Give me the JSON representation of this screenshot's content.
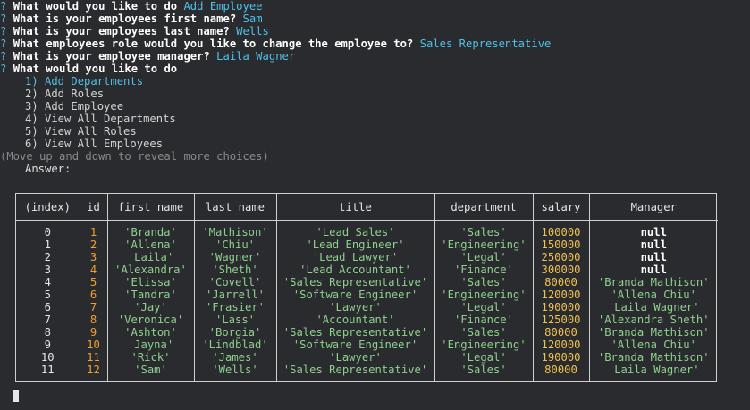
{
  "prompt": {
    "marker": "?",
    "lines": [
      {
        "question": "What would you like to do",
        "answer": "Add Employee"
      },
      {
        "question": "What is your employees first name?",
        "answer": "Sam"
      },
      {
        "question": "What is your employees last name?",
        "answer": "Wells"
      },
      {
        "question": "What employees role would you like to change the employee to?",
        "answer": "Sales Representative"
      },
      {
        "question": "What is your employee manager?",
        "answer": "Laila Wagner"
      },
      {
        "question": "What would you like to do",
        "answer": ""
      }
    ],
    "choices": [
      "1) Add Departments",
      "2) Add Roles",
      "3) Add Employee",
      "4) View All Departments",
      "5) View All Roles",
      "6) View All Employees"
    ],
    "active_choice": 0,
    "hint": "(Move up and down to reveal more choices)",
    "answer_label": "Answer:"
  },
  "table": {
    "columns": [
      "(index)",
      "id",
      "first_name",
      "last_name",
      "title",
      "department",
      "salary",
      "Manager"
    ],
    "index": [
      "0",
      "1",
      "2",
      "3",
      "4",
      "5",
      "6",
      "7",
      "8",
      "9",
      "10",
      "11"
    ],
    "id": [
      "1",
      "2",
      "3",
      "4",
      "5",
      "6",
      "7",
      "8",
      "9",
      "10",
      "11",
      "12"
    ],
    "first_name": [
      "'Branda'",
      "'Allena'",
      "'Laila'",
      "'Alexandra'",
      "'Elissa'",
      "'Tandra'",
      "'Jay'",
      "'Veronica'",
      "'Ashton'",
      "'Jayna'",
      "'Rick'",
      "'Sam'"
    ],
    "last_name": [
      "'Mathison'",
      "'Chiu'",
      "'Wagner'",
      "'Sheth'",
      "'Covell'",
      "'Jarrell'",
      "'Frasier'",
      "'Lass'",
      "'Borgia'",
      "'Lindblad'",
      "'James'",
      "'Wells'"
    ],
    "title": [
      "'Lead Sales'",
      "'Lead Engineer'",
      "'Lead Lawyer'",
      "'Lead Accountant'",
      "'Sales Representative'",
      "'Software Engineer'",
      "'Lawyer'",
      "'Accountant'",
      "'Sales Representative'",
      "'Software Engineer'",
      "'Lawyer'",
      "'Sales Representative'"
    ],
    "department": [
      "'Sales'",
      "'Engineering'",
      "'Legal'",
      "'Finance'",
      "'Sales'",
      "'Engineering'",
      "'Legal'",
      "'Finance'",
      "'Sales'",
      "'Engineering'",
      "'Legal'",
      "'Sales'"
    ],
    "salary": [
      "100000",
      "150000",
      "250000",
      "300000",
      "80000",
      "120000",
      "190000",
      "125000",
      "80000",
      "120000",
      "190000",
      "80000"
    ],
    "manager": [
      "null",
      "null",
      "null",
      "null",
      "'Branda Mathison'",
      "'Allena Chiu'",
      "'Laila Wagner'",
      "'Alexandra Sheth'",
      "'Branda Mathison'",
      "'Allena Chiu'",
      "'Branda Mathison'",
      "'Laila Wagner'"
    ]
  },
  "colors": {
    "background": "#2a2b2e",
    "answer": "#4fc1e9",
    "string": "#8ed08e",
    "number": "#f0c050",
    "id": "#f0a030"
  }
}
